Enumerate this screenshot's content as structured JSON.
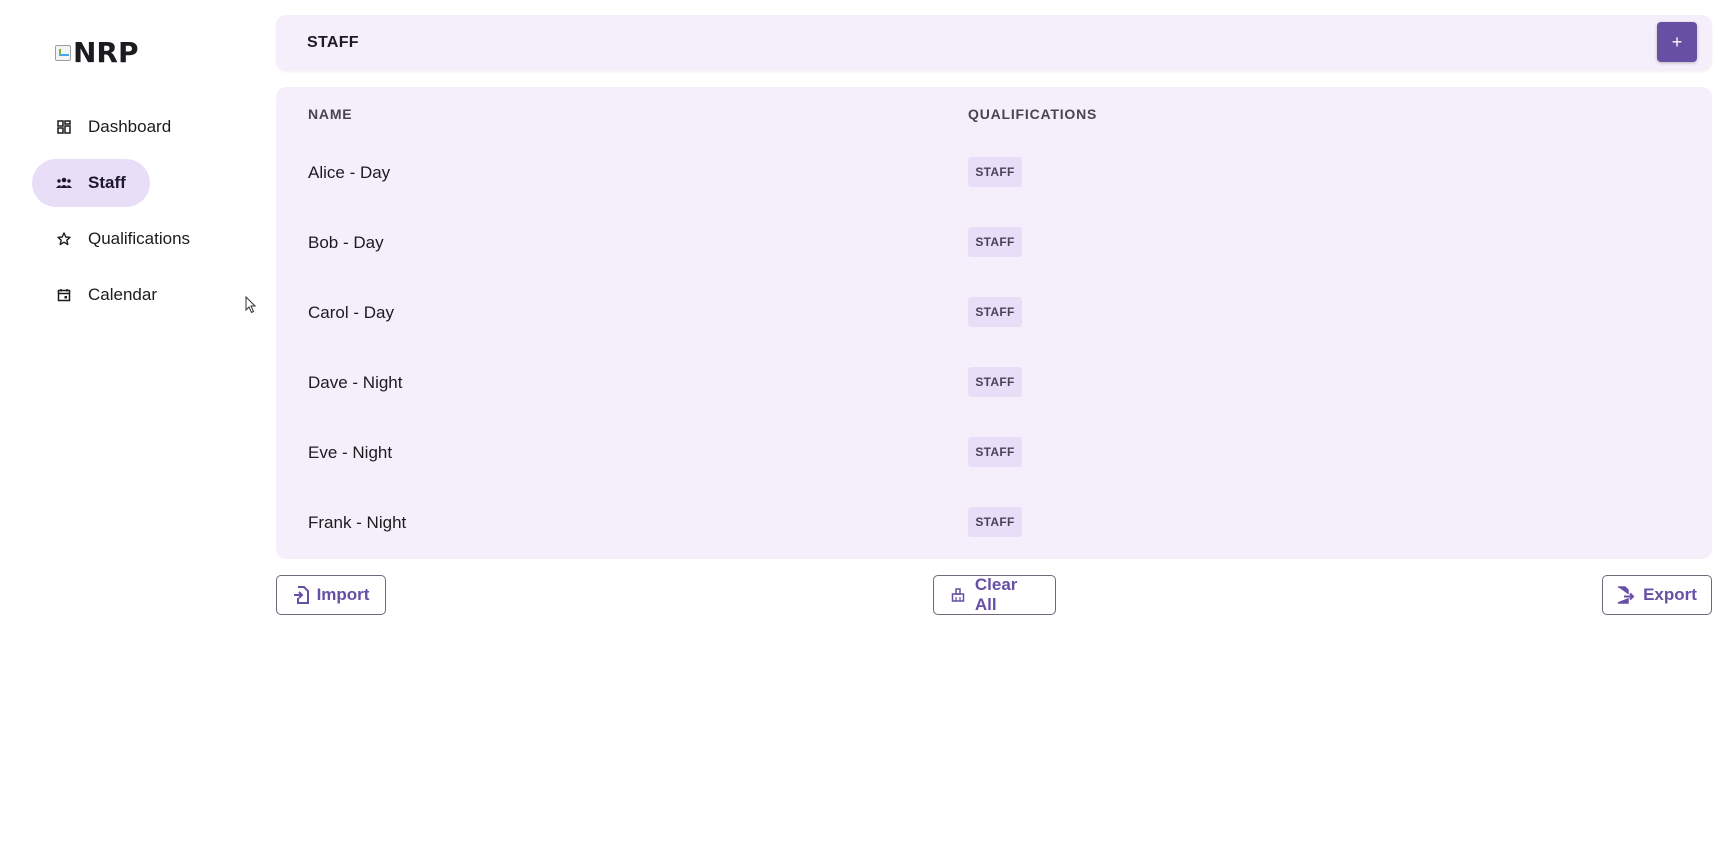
{
  "logo": {
    "alt_text": "NRP"
  },
  "sidebar": {
    "items": [
      {
        "label": "Dashboard",
        "icon": "dashboard-icon",
        "active": false
      },
      {
        "label": "Staff",
        "icon": "people-icon",
        "active": true
      },
      {
        "label": "Qualifications",
        "icon": "star-icon",
        "active": false
      },
      {
        "label": "Calendar",
        "icon": "calendar-icon",
        "active": false
      }
    ]
  },
  "header": {
    "title": "STAFF",
    "add_label": "+"
  },
  "table": {
    "columns": [
      "NAME",
      "QUALIFICATIONS"
    ],
    "rows": [
      {
        "name": "Alice - Day",
        "qualification": "STAFF"
      },
      {
        "name": "Bob - Day",
        "qualification": "STAFF"
      },
      {
        "name": "Carol - Day",
        "qualification": "STAFF"
      },
      {
        "name": "Dave - Night",
        "qualification": "STAFF"
      },
      {
        "name": "Eve - Night",
        "qualification": "STAFF"
      },
      {
        "name": "Frank - Night",
        "qualification": "STAFF"
      }
    ]
  },
  "actions": {
    "import_label": "Import",
    "clear_label": "Clear All",
    "export_label": "Export"
  },
  "colors": {
    "primary": "#6750a4",
    "surface": "#f5effb",
    "chip": "#e8def8"
  }
}
